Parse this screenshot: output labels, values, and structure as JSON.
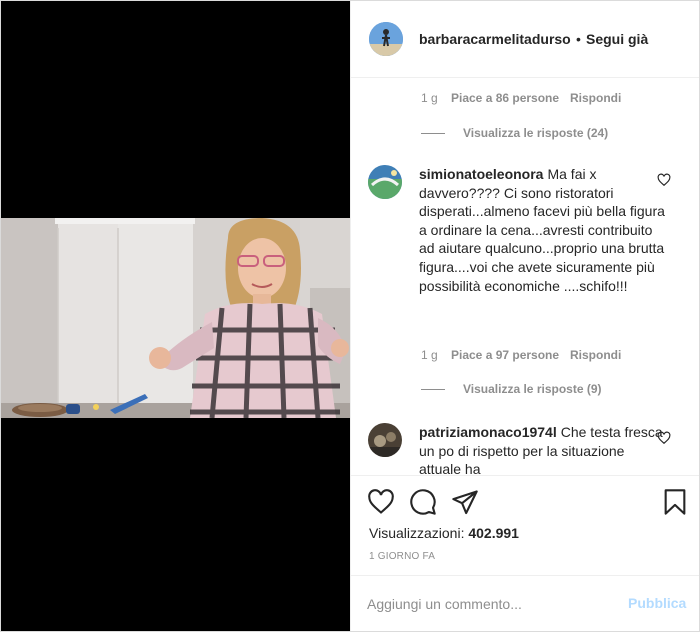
{
  "post": {
    "username": "barbaracarmelitadurso",
    "separator": "•",
    "follow_label": "Segui già"
  },
  "comments": {
    "reply1": {
      "time": "1 g",
      "likes": "Piace a 86 persone",
      "reply_label": "Rispondi",
      "view_replies": "Visualizza le risposte (24)"
    },
    "c1": {
      "user": "simionatoeleonora",
      "text": "Ma fai x davvero???? Ci sono ristoratori disperati...almeno facevi più bella figura a ordinare la cena...avresti contribuito ad aiutare qualcuno...proprio una brutta figura....voi che avete sicuramente più possibilità economiche ....schifo!!!",
      "time": "1 g",
      "likes": "Piace a 97 persone",
      "reply_label": "Rispondi",
      "view_replies": "Visualizza le risposte (9)"
    },
    "c2": {
      "user": "patriziamonaco1974l",
      "text": "Che testa fresca un po di rispetto per la situazione attuale ha"
    }
  },
  "actions": {
    "views_label": "Visualizzazioni:",
    "views_count": "402.991",
    "date": "1 GIORNO FA"
  },
  "add_comment": {
    "placeholder": "Aggiungi un commento...",
    "post_label": "Pubblica"
  },
  "icons": {
    "like": "heart-icon",
    "comment": "comment-icon",
    "share": "send-icon",
    "save": "bookmark-icon"
  },
  "colors": {
    "text": "#262626",
    "secondary": "#8e8e8e",
    "publish_disabled": "#b3dbff",
    "divider": "#efefef"
  }
}
